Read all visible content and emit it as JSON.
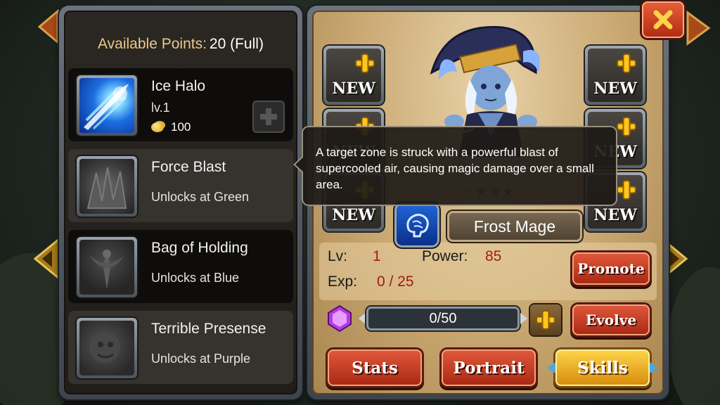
{
  "skills_panel": {
    "points_label": "Available Points:",
    "points_value": "20 (Full)",
    "skills": [
      {
        "name": "Ice Halo",
        "level": "lv.1",
        "cost": "100",
        "icon": "ice-halo-icon",
        "locked": false
      },
      {
        "name": "Force Blast",
        "unlock": "Unlocks at Green",
        "icon": "force-blast-icon",
        "locked": true
      },
      {
        "name": "Bag of Holding",
        "unlock": "Unlocks at Blue",
        "icon": "bag-of-holding-icon",
        "locked": true
      },
      {
        "name": "Terrible Presense",
        "unlock": "Unlocks at Purple",
        "icon": "terrible-presense-icon",
        "locked": true
      }
    ]
  },
  "tooltip": {
    "text": "A target zone is struck with a powerful blast of supercooled air, causing magic damage over a small area."
  },
  "hero": {
    "name": "Frost Mage",
    "class_icon": "brain-icon",
    "stars_filled": 2,
    "stars_total": 5,
    "lv_label": "Lv:",
    "lv_value": "1",
    "power_label": "Power:",
    "power_value": "85",
    "exp_label": "Exp:",
    "exp_value": "0 / 25",
    "gear_new_label": "NEW",
    "gear_slots": 6,
    "exp_bar_text": "0/50"
  },
  "buttons": {
    "promote": "Promote",
    "evolve": "Evolve",
    "stats": "Stats",
    "portrait": "Portrait",
    "skills": "Skills"
  },
  "colors": {
    "accent_gold": "#e9c98a",
    "stat_value_red": "#a31c12",
    "button_red": "#c23a1e",
    "button_gold": "#f0b020"
  }
}
